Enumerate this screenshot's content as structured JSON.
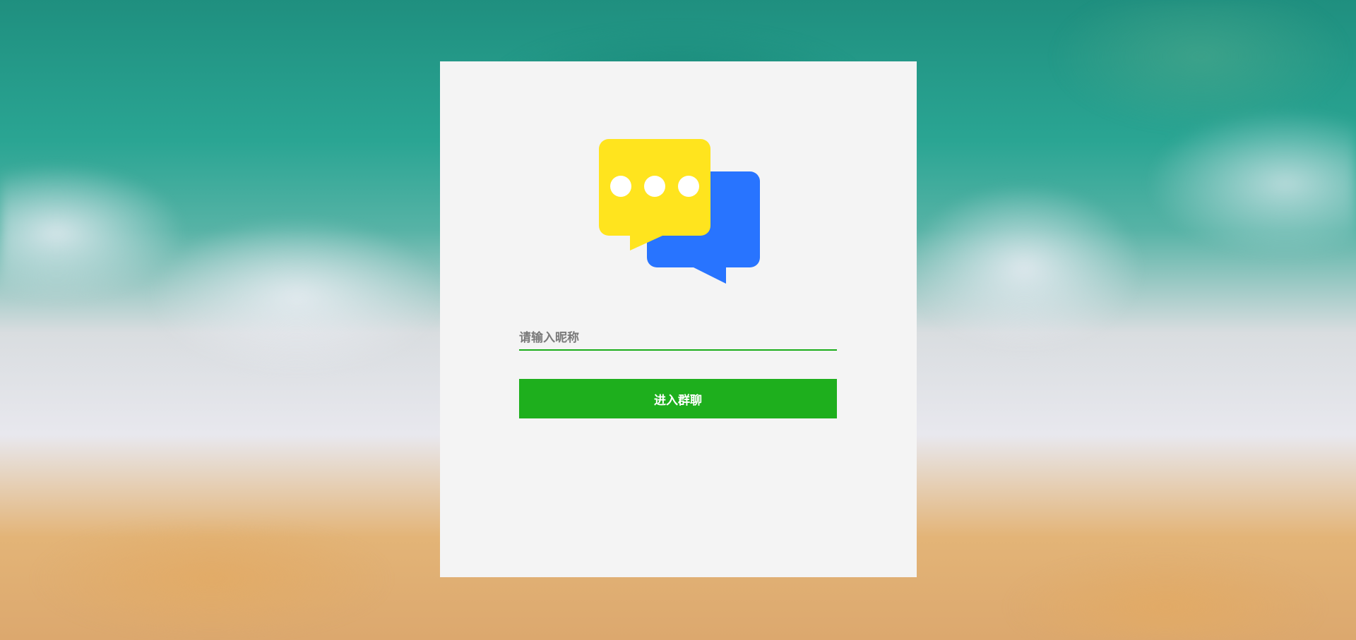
{
  "login": {
    "nickname_placeholder": "请输入昵称",
    "nickname_value": "",
    "enter_button_label": "进入群聊"
  },
  "logo": {
    "icon": "chat-bubbles-icon",
    "colors": {
      "front_bubble": "#ffe41e",
      "back_bubble": "#2874ff",
      "dots": "#ffffff"
    }
  },
  "theme": {
    "card_background": "#f4f4f4",
    "accent": "#1eaf1d"
  }
}
